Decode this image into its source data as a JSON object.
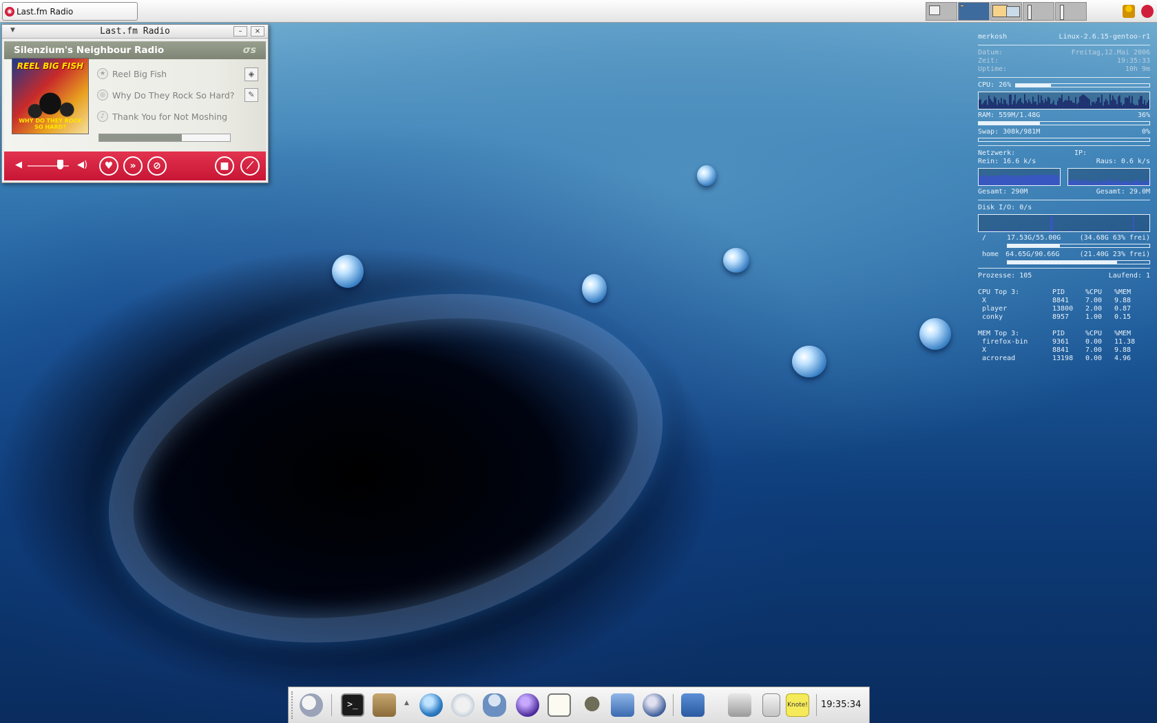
{
  "taskbar": {
    "task_title": "Last.fm Radio"
  },
  "lastfm": {
    "window_title": "Last.fm Radio",
    "minimize": "–",
    "close": "×",
    "station": "Silenzium's Neighbour Radio",
    "album_text_top": "REEL BIG FISH",
    "album_text_bottom": "WHY DO THEY ROCK SO HARD?",
    "artist": "Reel Big Fish",
    "album": "Why Do They Rock So Hard?",
    "track": "Thank You for Not Moshing",
    "progress": 0.63,
    "volume": 0.78,
    "accent_color": "#d01f3c"
  },
  "conky": {
    "user": "merkosh",
    "kernel": "Linux-2.6.15-gentoo-r1",
    "datum_label": "Datum:",
    "datum_value": "Freitag,12.Mai 2006",
    "zeit_label": "Zeit:",
    "zeit_value": "19:35:33",
    "uptime_label": "Uptime:",
    "uptime_value": "10h 9m",
    "cpu_label": "CPU:",
    "cpu_value": "26%",
    "cpu_fraction": 0.26,
    "ram_label": "RAM:",
    "ram_value": "559M/1.48G",
    "ram_percent": "36%",
    "ram_fraction": 0.36,
    "swap_label": "Swap:",
    "swap_value": "308k/981M",
    "swap_percent": "0%",
    "swap_fraction": 0.0,
    "net_label": "Netzwerk:",
    "ip_label": "IP:",
    "rein_label": "Rein:",
    "rein_value": "16.6 k/s",
    "raus_label": "Raus:",
    "raus_value": "0.6 k/s",
    "gesamt_in_label": "Gesamt:",
    "gesamt_in_value": "290M",
    "gesamt_out_label": "Gesamt:",
    "gesamt_out_value": "29.0M",
    "disk_label": "Disk I/O:",
    "disk_value": "0/s",
    "fs_root_name": "/",
    "fs_root_value": "17.53G/55.00G",
    "fs_root_free": "(34.68G 63% frei)",
    "fs_root_fraction": 0.37,
    "fs_home_name": "home",
    "fs_home_value": "64.65G/90.66G",
    "fs_home_free": "(21.40G 23% frei)",
    "fs_home_fraction": 0.77,
    "prozesse_label": "Prozesse:",
    "prozesse_value": "105",
    "laufend_label": "Laufend:",
    "laufend_value": "1",
    "cpu_top_title": "CPU Top 3:",
    "mem_top_title": "MEM Top 3:",
    "col_pid": "PID",
    "col_cpu": "%CPU",
    "col_mem": "%MEM",
    "cpu_top": [
      {
        "name": " X",
        "pid": "8841",
        "cpu": "7.00",
        "mem": "9.88"
      },
      {
        "name": " player",
        "pid": "13800",
        "cpu": "2.00",
        "mem": "0.87"
      },
      {
        "name": " conky",
        "pid": "8957",
        "cpu": "1.00",
        "mem": "0.15"
      }
    ],
    "mem_top": [
      {
        "name": " firefox-bin",
        "pid": "9361",
        "cpu": "0.00",
        "mem": "11.38"
      },
      {
        "name": " X",
        "pid": "8841",
        "cpu": "7.00",
        "mem": "9.88"
      },
      {
        "name": " acroread",
        "pid": "13198",
        "cpu": "0.00",
        "mem": "4.96"
      }
    ]
  },
  "dock": {
    "clock": "19:35:34",
    "note_label": "Knote!"
  }
}
